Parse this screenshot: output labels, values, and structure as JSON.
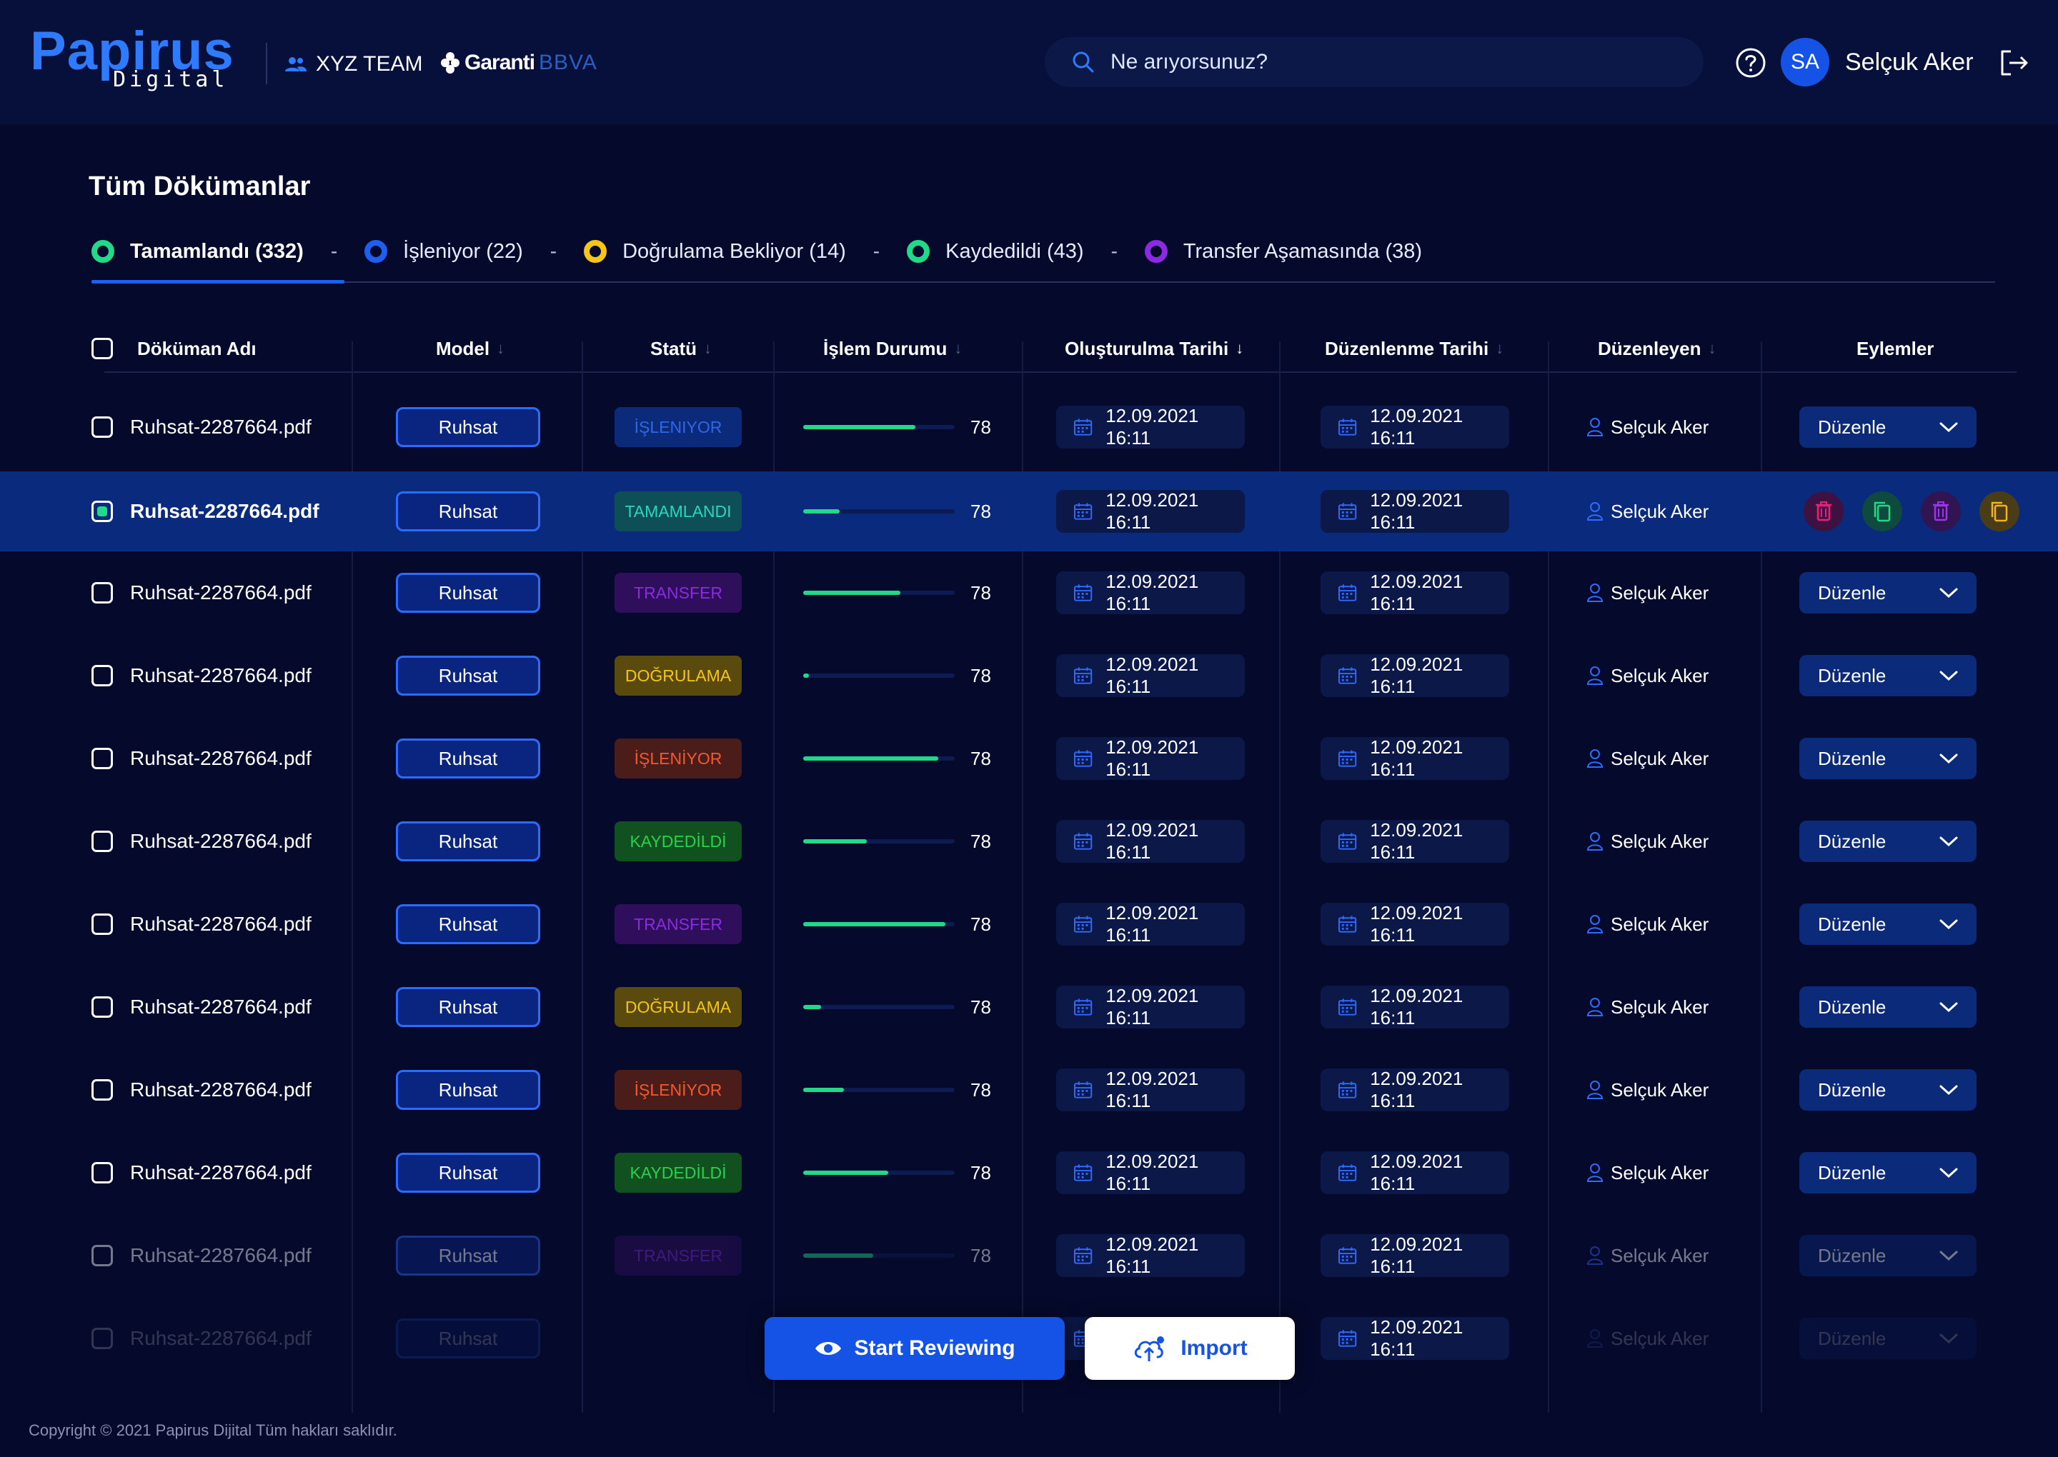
{
  "header": {
    "logo_text": "Papirus",
    "logo_sub": "Digital",
    "team": "XYZ TEAM",
    "brand_primary": "Garanti",
    "brand_secondary": "BBVA",
    "search_placeholder": "Ne arıyorsunuz?",
    "avatar_initials": "SA",
    "user_name": "Selçuk Aker"
  },
  "page": {
    "title": "Tüm Dökümanlar"
  },
  "tabs": [
    {
      "label": "Tamamlandı (332)",
      "color": "#22d98a",
      "active": true
    },
    {
      "label": "İşleniyor (22)",
      "color": "#1f5ff0",
      "active": false
    },
    {
      "label": "Doğrulama Bekliyor (14)",
      "color": "#f5c518",
      "active": false
    },
    {
      "label": "Kaydedildi (43)",
      "color": "#22d98a",
      "active": false
    },
    {
      "label": "Transfer Aşamasında (38)",
      "color": "#8a2be2",
      "active": false
    }
  ],
  "table": {
    "columns": [
      "Döküman Adı",
      "Model",
      "Statü",
      "İşlem Durumu",
      "Oluşturulma Tarihi",
      "Düzenlenme Tarihi",
      "Düzenleyen",
      "Eylemler"
    ],
    "rows": [
      {
        "name": "Ruhsat-2287664.pdf",
        "model": "Ruhsat",
        "status": "İŞLENIYOR",
        "status_class": "st-isleniyor",
        "progress": 0.74,
        "value": "78",
        "created": "12.09.2021 16:11",
        "edited": "12.09.2021 16:11",
        "editor": "Selçuk Aker",
        "action": "Düzenle"
      },
      {
        "name": "Ruhsat-2287664.pdf",
        "model": "Ruhsat",
        "status": "TAMAMLANDI",
        "status_class": "st-tamam",
        "progress": 0.24,
        "value": "78",
        "created": "12.09.2021 16:11",
        "edited": "12.09.2021 16:11",
        "editor": "Selçuk Aker",
        "action": "Düzenle",
        "selected": true
      },
      {
        "name": "Ruhsat-2287664.pdf",
        "model": "Ruhsat",
        "status": "TRANSFER",
        "status_class": "st-transfer",
        "progress": 0.64,
        "value": "78",
        "created": "12.09.2021 16:11",
        "edited": "12.09.2021 16:11",
        "editor": "Selçuk Aker",
        "action": "Düzenle"
      },
      {
        "name": "Ruhsat-2287664.pdf",
        "model": "Ruhsat",
        "status": "DOĞRULAMA",
        "status_class": "st-dogrulama",
        "progress": 0.04,
        "value": "78",
        "created": "12.09.2021 16:11",
        "edited": "12.09.2021 16:11",
        "editor": "Selçuk Aker",
        "action": "Düzenle"
      },
      {
        "name": "Ruhsat-2287664.pdf",
        "model": "Ruhsat",
        "status": "İŞLENİYOR",
        "status_class": "st-isleniyor2",
        "progress": 0.89,
        "value": "78",
        "created": "12.09.2021 16:11",
        "edited": "12.09.2021 16:11",
        "editor": "Selçuk Aker",
        "action": "Düzenle"
      },
      {
        "name": "Ruhsat-2287664.pdf",
        "model": "Ruhsat",
        "status": "KAYDEDİLDİ",
        "status_class": "st-kaydedildi",
        "progress": 0.42,
        "value": "78",
        "created": "12.09.2021 16:11",
        "edited": "12.09.2021 16:11",
        "editor": "Selçuk Aker",
        "action": "Düzenle"
      },
      {
        "name": "Ruhsat-2287664.pdf",
        "model": "Ruhsat",
        "status": "TRANSFER",
        "status_class": "st-transfer",
        "progress": 0.94,
        "value": "78",
        "created": "12.09.2021 16:11",
        "edited": "12.09.2021 16:11",
        "editor": "Selçuk Aker",
        "action": "Düzenle"
      },
      {
        "name": "Ruhsat-2287664.pdf",
        "model": "Ruhsat",
        "status": "DOĞRULAMA",
        "status_class": "st-dogrulama",
        "progress": 0.12,
        "value": "78",
        "created": "12.09.2021 16:11",
        "edited": "12.09.2021 16:11",
        "editor": "Selçuk Aker",
        "action": "Düzenle"
      },
      {
        "name": "Ruhsat-2287664.pdf",
        "model": "Ruhsat",
        "status": "İŞLENİYOR",
        "status_class": "st-isleniyor2",
        "progress": 0.27,
        "value": "78",
        "created": "12.09.2021 16:11",
        "edited": "12.09.2021 16:11",
        "editor": "Selçuk Aker",
        "action": "Düzenle"
      },
      {
        "name": "Ruhsat-2287664.pdf",
        "model": "Ruhsat",
        "status": "KAYDEDİLDİ",
        "status_class": "st-kaydedildi",
        "progress": 0.56,
        "value": "78",
        "created": "12.09.2021 16:11",
        "edited": "12.09.2021 16:11",
        "editor": "Selçuk Aker",
        "action": "Düzenle"
      },
      {
        "name": "Ruhsat-2287664.pdf",
        "model": "Ruhsat",
        "status": "TRANSFER",
        "status_class": "st-transfer",
        "progress": 0.46,
        "value": "78",
        "created": "12.09.2021 16:11",
        "edited": "12.09.2021 16:11",
        "editor": "Selçuk Aker",
        "action": "Düzenle",
        "fade": 1
      },
      {
        "name": "Ruhsat-2287664.pdf",
        "model": "Ruhsat",
        "status": "DOĞRULAMA",
        "status_class": "st-dogrulama",
        "progress": 0.0,
        "value": "78",
        "created": "12.09.2021 16:11",
        "edited": "12.09.2021 16:11",
        "editor": "Selçuk Aker",
        "action": "Düzenle",
        "fade": 2
      }
    ]
  },
  "buttons": {
    "review": "Start Reviewing",
    "import": "Import"
  },
  "footer": {
    "copyright": "Copyright © 2021 Papirus Dijital Tüm hakları saklıdır."
  }
}
